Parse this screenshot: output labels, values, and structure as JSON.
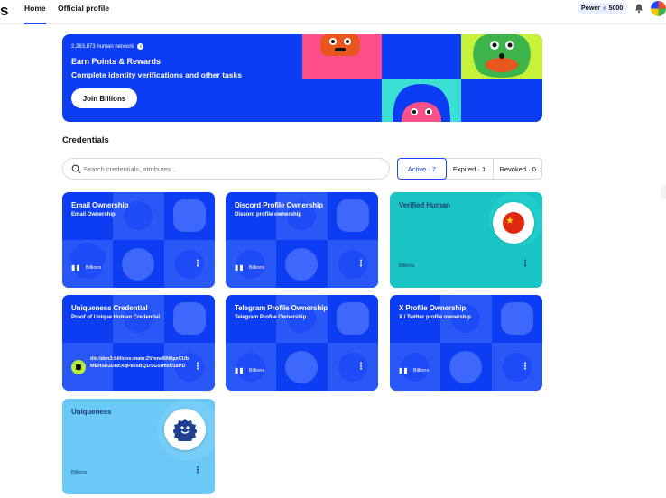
{
  "nav": {
    "logo": "s",
    "tabs": [
      "Home",
      "Official profile"
    ],
    "power_label": "Power",
    "power_value": "5000"
  },
  "banner": {
    "network": "2,383,873 human network",
    "title": "Earn Points & Rewards",
    "subtitle": "Complete identity verifications and other tasks",
    "cta": "Join Billions"
  },
  "credentials": {
    "heading": "Credentials",
    "search_placeholder": "Search credentials, attributes...",
    "filters": [
      "Active · 7",
      "Expired · 1",
      "Revoked · 0"
    ],
    "cards": [
      {
        "title": "Email Ownership",
        "subtitle": "Email Ownership",
        "issuer": "Billions"
      },
      {
        "title": "Discord Profile Ownership",
        "subtitle": "Discord profile ownership",
        "issuer": "Billions"
      },
      {
        "title": "Verified Human",
        "subtitle": "",
        "issuer": "Billions"
      },
      {
        "title": "Uniqueness Credential",
        "subtitle": "Proof of Unique Human Credential",
        "issuer": "did:iden3:billions:main:2VmneBNitpxCUbMEHSR2DNcXqPassBQ1r5G5rmeU18PD"
      },
      {
        "title": "Telegram Profile Ownership",
        "subtitle": "Telegram Profile Ownership",
        "issuer": "Billions"
      },
      {
        "title": "X Profile Ownership",
        "subtitle": "X / Twitter profile ownership",
        "issuer": "Billions"
      },
      {
        "title": "Uniqueness",
        "subtitle": "",
        "issuer": "Billions"
      }
    ]
  },
  "colors": {
    "brand_blue": "#0d3df2",
    "teal": "#19c8c8",
    "light_blue": "#68c7f6",
    "lime": "#b8ef3d",
    "pink": "#ff4f8b"
  }
}
